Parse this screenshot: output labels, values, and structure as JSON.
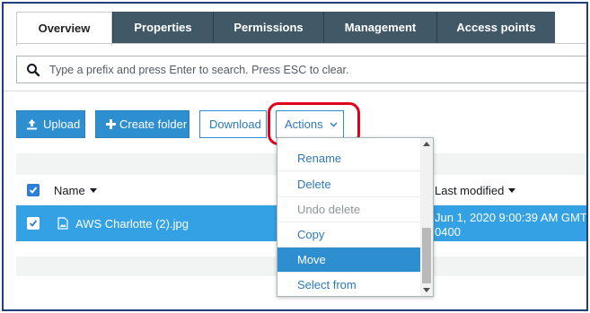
{
  "tabs": [
    {
      "label": "Overview",
      "active": true
    },
    {
      "label": "Properties",
      "active": false
    },
    {
      "label": "Permissions",
      "active": false
    },
    {
      "label": "Management",
      "active": false
    },
    {
      "label": "Access points",
      "active": false
    }
  ],
  "search": {
    "placeholder": "Type a prefix and press Enter to search. Press ESC to clear.",
    "value": ""
  },
  "toolbar": {
    "upload_label": "Upload",
    "create_folder_label": "Create folder",
    "download_label": "Download",
    "actions_label": "Actions"
  },
  "table": {
    "columns": {
      "name": "Name",
      "last_modified": "Last modified"
    },
    "rows": [
      {
        "name": "AWS Charlotte (2).jpg",
        "last_modified_line1": "Jun 1, 2020 9:00:39 AM GMT-",
        "last_modified_line2": "0400",
        "selected": true
      }
    ]
  },
  "actions_menu": {
    "items": [
      {
        "label": "Rename",
        "state": "normal"
      },
      {
        "label": "Delete",
        "state": "normal"
      },
      {
        "label": "Undo delete",
        "state": "disabled"
      },
      {
        "label": "Copy",
        "state": "normal"
      },
      {
        "label": "Move",
        "state": "active"
      },
      {
        "label": "Select from",
        "state": "normal"
      }
    ]
  },
  "colors": {
    "tab_bg": "#415867",
    "accent_blue": "#2e8fd0",
    "selected_row": "#33a1e4",
    "highlight_ring": "#e0001b",
    "frame_border": "#1f3f7f"
  }
}
